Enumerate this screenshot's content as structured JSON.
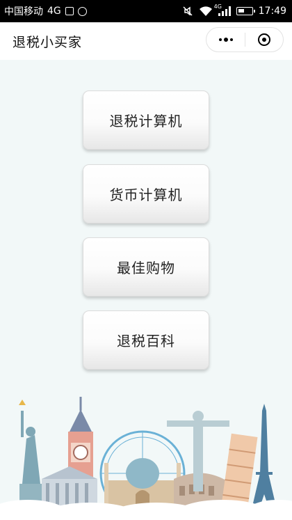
{
  "status_bar": {
    "carrier": "中国移动",
    "network": "4G",
    "signal_tag": "4G",
    "time": "17:49"
  },
  "nav": {
    "title": "退税小买家"
  },
  "menu": {
    "items": [
      {
        "label": "退税计算机"
      },
      {
        "label": "货币计算机"
      },
      {
        "label": "最佳购物"
      },
      {
        "label": "退税百科"
      }
    ]
  },
  "colors": {
    "background": "#f2f8f8",
    "status_bar": "#000000",
    "nav_bar": "#ffffff"
  },
  "icons": [
    "image-icon",
    "cat-face-icon",
    "mute-icon",
    "wifi-icon",
    "signal-icon",
    "battery-icon",
    "more-icon",
    "close-mini-program-icon",
    "world-landmarks-illustration"
  ]
}
